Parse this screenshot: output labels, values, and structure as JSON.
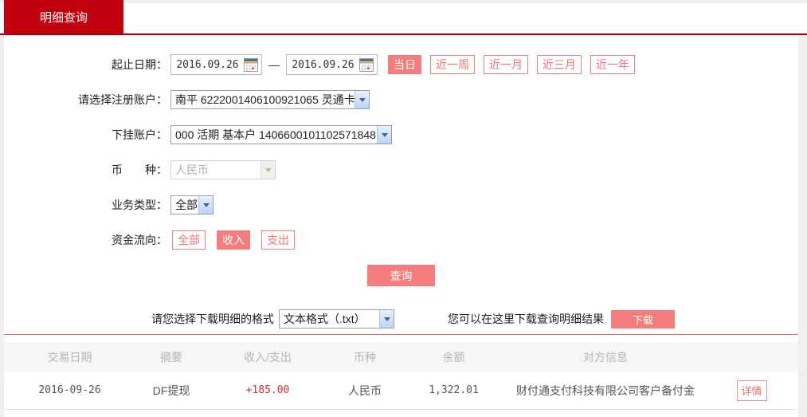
{
  "colors": {
    "brand_red": "#c3000d",
    "header_rule_red": "#ab0006",
    "accent_salmon": "#f47c7c",
    "amount_red": "#d22f2f",
    "table_rule_red": "#e96464"
  },
  "tab": {
    "label": "明细查询"
  },
  "form": {
    "date": {
      "label": "起止日期：",
      "start": "2016.09.26",
      "separator": "—",
      "end": "2016.09.26"
    },
    "quick_ranges": {
      "today": "当日",
      "week": "近一周",
      "month": "近一月",
      "quarter": "近三月",
      "year": "近一年"
    },
    "register_account": {
      "label": "请选择注册账户：",
      "value": "南平 6222001406100921065 灵通卡"
    },
    "sub_account": {
      "label": "下挂账户：",
      "value": "000 活期 基本户 1406600101102571848"
    },
    "currency": {
      "label": "币　　种：",
      "value": "人民币"
    },
    "business_type": {
      "label": "业务类型：",
      "value": "全部"
    },
    "fund_flow": {
      "label": "资金流向：",
      "all": "全部",
      "income": "收入",
      "expense": "支出"
    },
    "query_button": "查询"
  },
  "download": {
    "format_label": "请您选择下载明细的格式",
    "format_value": "文本格式（.txt）",
    "hint": "您可以在这里下载查询明细结果",
    "button": "下载"
  },
  "table": {
    "headers": [
      "交易日期",
      "摘要",
      "收入/支出",
      "币种",
      "余额",
      "对方信息"
    ],
    "rows": [
      {
        "date": "2016-09-26",
        "summary": "DF提现",
        "amount": "+185.00",
        "currency": "人民币",
        "balance": "1,322.01",
        "counterparty": "财付通支付科技有限公司客户备付金",
        "action": "详情"
      }
    ]
  }
}
